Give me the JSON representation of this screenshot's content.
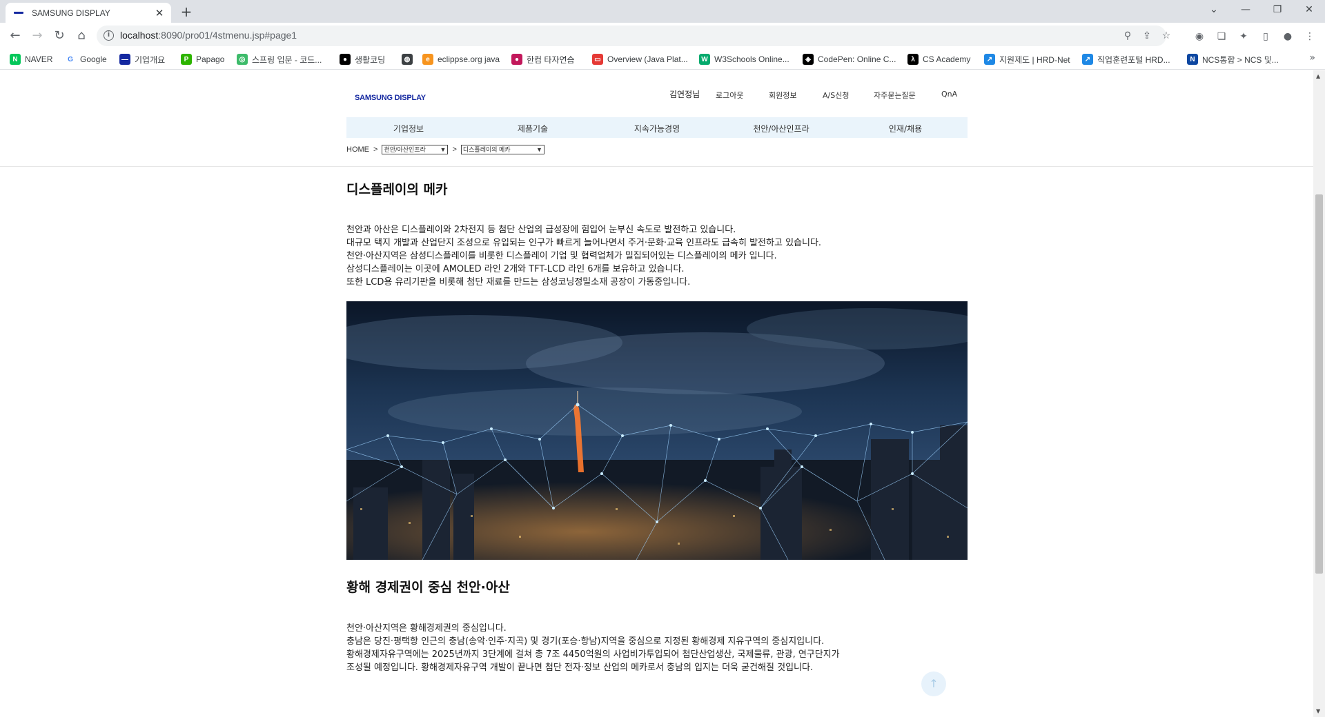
{
  "browser": {
    "tab_title": "SAMSUNG DISPLAY",
    "url_host": "localhost",
    "url_path": ":8090/pro01/4stmenu.jsp#page1",
    "bookmarks": [
      {
        "label": "NAVER",
        "color": "#03c75a",
        "glyph": "N"
      },
      {
        "label": "Google",
        "color": "#ffffff",
        "glyph": "G"
      },
      {
        "label": "기업개요",
        "color": "#1428a0",
        "glyph": "—"
      },
      {
        "label": "Papago",
        "color": "#2db400",
        "glyph": "P"
      },
      {
        "label": "스프링 입문 - 코드...",
        "color": "#3dbb6a",
        "glyph": "◎"
      },
      {
        "label": "생활코딩",
        "color": "#000000",
        "glyph": "●"
      },
      {
        "label": "",
        "color": "#3c4043",
        "glyph": "◍"
      },
      {
        "label": "eclippse.org java",
        "color": "#f7941e",
        "glyph": "e"
      },
      {
        "label": "한컴 타자연습",
        "color": "#c2185b",
        "glyph": "●"
      },
      {
        "label": "Overview (Java Plat...",
        "color": "#e53935",
        "glyph": "▭"
      },
      {
        "label": "W3Schools Online...",
        "color": "#04aa6d",
        "glyph": "W"
      },
      {
        "label": "CodePen: Online C...",
        "color": "#000000",
        "glyph": "◈"
      },
      {
        "label": "CS Academy",
        "color": "#000000",
        "glyph": "λ"
      },
      {
        "label": "지원제도 | HRD-Net",
        "color": "#1e88e5",
        "glyph": "↗"
      },
      {
        "label": "직업훈련포털 HRD...",
        "color": "#1e88e5",
        "glyph": "↗"
      },
      {
        "label": "NCS통합 > NCS 및...",
        "color": "#0d47a1",
        "glyph": "N"
      }
    ]
  },
  "site": {
    "logo": "SAMSUNG DISPLAY",
    "util": {
      "user": "김연정님",
      "logout": "로그아웃",
      "member_info": "회원정보",
      "as": "A/S신청",
      "faq": "자주묻는질문",
      "qna": "QnA"
    },
    "gnb": [
      "기업정보",
      "제품기술",
      "지속가능경영",
      "천안/아산인프라",
      "인재/채용"
    ],
    "breadcrumb": {
      "home": "HOME",
      "sep": ">",
      "select1": "천안/아산인프라",
      "select2": "디스플레이의 메카"
    }
  },
  "content": {
    "section1_title": "디스플레이의 메카",
    "section1_lines": [
      "천안과 아산은 디스플레이와 2차전지 등 첨단 산업의 급성장에 힘입어 눈부신 속도로 발전하고 있습니다.",
      "대규모 택지 개발과 산업단지 조성으로 유입되는 인구가 빠르게 늘어나면서 주거·문화·교육 인프라도 급속히 발전하고 있습니다.",
      "천안·아산지역은 삼성디스플레이를 비롯한 디스플레이 기업 및 협력업체가 밀집되어있는 디스플레이의 메카 입니다.",
      "삼성디스플레이는 이곳에 AMOLED 라인 2개와 TFT-LCD 라인 6개를 보유하고 있습니다.",
      "또한 LCD용 유리기판을 비롯해 첨단 재료를 만드는 삼성코닝정밀소재 공장이 가동중입니다."
    ],
    "section2_title": "황해 경제권이 중심 천안·아산",
    "section2_lines": [
      "천안·아산지역은 황해경제권의 중심입니다.",
      "충남은 당진·평택항 인근의 충남(송악·인주·지곡) 및 경기(포승·항남)지역을 중심으로 지정된 황해경제 지유구역의 중심지입니다.",
      "황해경제자유구역에는 2025년까지 3단계에 걸쳐 총 7조 4450억원의 사업비가투입되어 첨단산업생산, 국제물류, 관광, 연구단지가",
      "조성될 예정입니다. 황해경제자유구역 개발이 끝나면 첨단 전자·정보 산업의 메카로서 충남의 입지는 더욱 굳건해질 것입니다."
    ],
    "to_top": "↑"
  }
}
